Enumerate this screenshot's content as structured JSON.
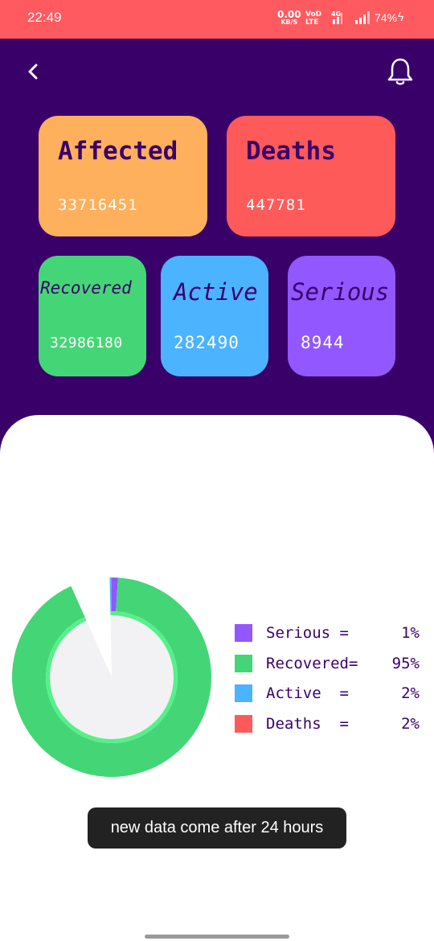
{
  "status_bar": {
    "time": "22:49",
    "net_speed": "0.00",
    "net_unit": "KB/S",
    "volte_top": "VoD",
    "volte_bottom": "LTE",
    "network": "4G",
    "battery": "74%"
  },
  "nav": {
    "back_icon": "chevron-left-icon",
    "bell_icon": "bell-icon"
  },
  "cards": {
    "affected": {
      "title": "Affected",
      "value": "33716451",
      "color": "#ffb05c"
    },
    "deaths": {
      "title": "Deaths",
      "value": "447781",
      "color": "#ff5a5a"
    },
    "recovered": {
      "title": "Recovered",
      "value": "32986180",
      "color": "#44d676"
    },
    "active": {
      "title": "Active",
      "value": "282490",
      "color": "#4bb3ff"
    },
    "serious": {
      "title": "Serious",
      "value": "8944",
      "color": "#9257ff"
    }
  },
  "chart_data": {
    "type": "pie",
    "style": "donut",
    "categories": [
      "Serious",
      "Recovered",
      "Active",
      "Deaths"
    ],
    "values": [
      1,
      95,
      2,
      2
    ],
    "colors": [
      "#9257ff",
      "#44d676",
      "#4bb3ff",
      "#ff5a5a"
    ],
    "legend": [
      {
        "label": "Serious =",
        "value": "1%",
        "color": "#9257ff"
      },
      {
        "label": "Recovered=",
        "value": "95%",
        "color": "#44d676"
      },
      {
        "label": "Active  =",
        "value": "2%",
        "color": "#4bb3ff"
      },
      {
        "label": "Deaths  =",
        "value": "2%",
        "color": "#ff5a5a"
      }
    ],
    "legend_placement": "right"
  },
  "toast": {
    "message": "new data come after 24 hours"
  }
}
